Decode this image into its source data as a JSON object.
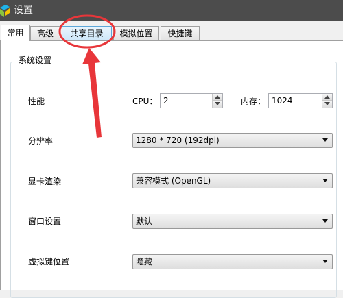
{
  "window": {
    "title": "设置"
  },
  "tabs": [
    {
      "label": "常用",
      "active": true
    },
    {
      "label": "高级",
      "active": false
    },
    {
      "label": "共享目录",
      "active": false,
      "highlighted": true
    },
    {
      "label": "模拟位置",
      "active": false
    },
    {
      "label": "快捷键",
      "active": false
    }
  ],
  "system": {
    "group_title": "系统设置",
    "performance": {
      "label": "性能",
      "cpu_label": "CPU：",
      "cpu_value": "2",
      "memory_label": "内存：",
      "memory_value": "1024"
    },
    "resolution": {
      "label": "分辨率",
      "value": "1280 * 720 (192dpi)"
    },
    "graphics": {
      "label": "显卡渲染",
      "value": "兼容模式 (OpenGL)"
    },
    "window_setting": {
      "label": "窗口设置",
      "value": "默认"
    },
    "virtual_keys": {
      "label": "虚拟键位置",
      "value": "隐藏"
    }
  },
  "annotation": {
    "color": "#e8363a"
  }
}
